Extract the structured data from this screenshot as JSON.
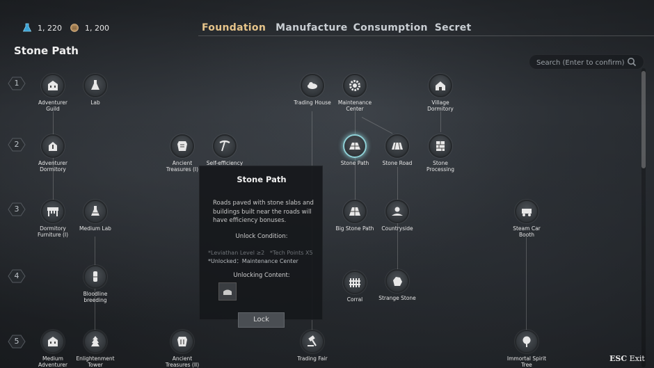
{
  "resources": [
    {
      "icon": "flask-icon",
      "value": "1, 220"
    },
    {
      "icon": "ore-icon",
      "value": "1, 200"
    }
  ],
  "tabs": [
    "Foundation",
    "Manufacture",
    "Consumption",
    "Secret"
  ],
  "active_tab": "Foundation",
  "page_title": "Stone Path",
  "search": {
    "placeholder": "Search (Enter to confirm)"
  },
  "rows": [
    "1",
    "2",
    "3",
    "4",
    "5"
  ],
  "nodes": {
    "adventurer_guild": "Adventurer Guild",
    "lab": "Lab",
    "trading_house": "Trading House",
    "maintenance_center": "Maintenance Center",
    "village_dormitory": "Village Dormitory",
    "adventurer_dormitory": "Adventurer Dormitory",
    "ancient_treasures_1": "Ancient Treasures (I)",
    "self_efficiency": "Self-efficiency",
    "stone_path": "Stone Path",
    "stone_road": "Stone Road",
    "stone_processing": "Stone Processing",
    "dormitory_furniture": "Dormitory Furniture (I)",
    "medium_lab": "Medium Lab",
    "big_stone_path": "Big Stone Path",
    "countryside": "Countryside",
    "steam_car_booth": "Steam Car Booth",
    "bloodline_breeding": "Bloodline breeding",
    "corral": "Corral",
    "strange_stone": "Strange Stone",
    "medium_adventurer": "Medium Adventurer",
    "enlightenment_tower": "Enlightenment Tower",
    "ancient_treasures_2": "Ancient Treasures (II)",
    "trading_fair": "Trading Fair",
    "immortal_spirit_tree": "Immortal Spirit Tree"
  },
  "popup": {
    "title": "Stone Path",
    "description": "Roads paved with stone slabs and buildings built near the roads will have efficiency bonuses.",
    "unlock_condition_label": "Unlock Condition:",
    "req_level": "*Leviathan Level ≥2",
    "req_tech": "*Tech Points X5",
    "req_unlocked": "*Unlocked：Maintenance Center",
    "unlocking_content_label": "Unlocking Content:",
    "button": "Lock"
  },
  "exit": {
    "key": "ESC",
    "label": "Exit"
  },
  "colors": {
    "active_tab": "#e6c48a",
    "selected_glow": "#8fd0d6"
  }
}
